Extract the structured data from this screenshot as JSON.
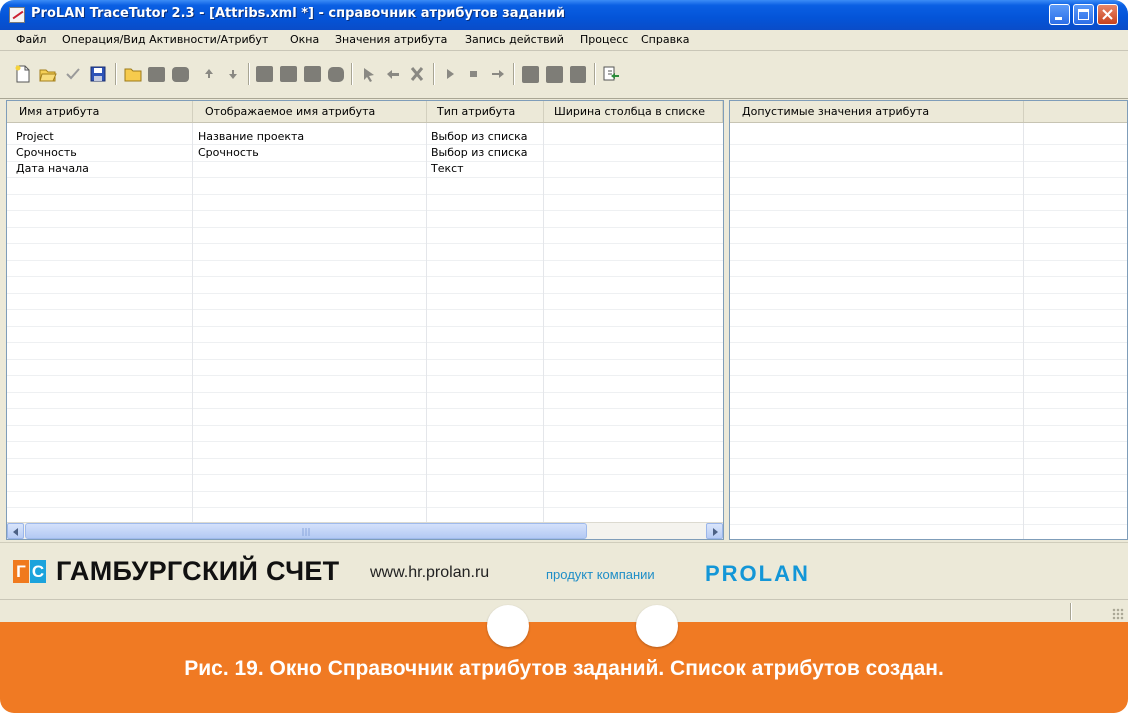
{
  "window": {
    "title": "ProLAN TraceTutor 2.3 - [Attribs.xml *] - справочник атрибутов заданий"
  },
  "menu": {
    "items": [
      "Файл",
      "Операция/Вид Активности/Атрибут",
      "Окна",
      "Значения атрибута",
      "Запись действий",
      "Процесс",
      "Справка"
    ]
  },
  "toolbar": {
    "buttons": [
      {
        "icon": "new-file-icon",
        "enabled": true
      },
      {
        "icon": "open-folder-icon",
        "enabled": true
      },
      {
        "icon": "checkmark-icon",
        "enabled": true
      },
      {
        "icon": "save-icon",
        "enabled": true
      },
      {
        "icon": "folder-icon",
        "enabled": true
      },
      {
        "icon": "add-item-icon",
        "enabled": false
      },
      {
        "icon": "delete-item-icon",
        "enabled": false
      },
      {
        "icon": "move-up-icon",
        "enabled": false
      },
      {
        "icon": "move-down-icon",
        "enabled": false
      },
      {
        "icon": "doc-1-icon",
        "enabled": false
      },
      {
        "icon": "doc-2-icon",
        "enabled": false
      },
      {
        "icon": "doc-3-icon",
        "enabled": false
      },
      {
        "icon": "doc-4-icon",
        "enabled": false
      },
      {
        "icon": "pointer-icon",
        "enabled": false
      },
      {
        "icon": "undo-icon",
        "enabled": false
      },
      {
        "icon": "cut-icon",
        "enabled": false
      },
      {
        "icon": "play-icon",
        "enabled": false
      },
      {
        "icon": "stop-icon",
        "enabled": false
      },
      {
        "icon": "step-icon",
        "enabled": false
      },
      {
        "icon": "record-1-icon",
        "enabled": false
      },
      {
        "icon": "record-2-icon",
        "enabled": false
      },
      {
        "icon": "record-3-icon",
        "enabled": false
      },
      {
        "icon": "export-icon",
        "enabled": true
      }
    ]
  },
  "attributes_table": {
    "columns": [
      "Имя атрибута",
      "Отображаемое имя атрибута",
      "Тип атрибута",
      "Ширина столбца в списке"
    ],
    "rows": [
      [
        "Project",
        "Название проекта",
        "Выбор из списка",
        ""
      ],
      [
        "Срочность",
        "Срочность",
        "Выбор из списка",
        ""
      ],
      [
        "Дата начала",
        "",
        "Текст",
        ""
      ]
    ]
  },
  "values_table": {
    "columns": [
      "Допустимые значения атрибута",
      ""
    ]
  },
  "banner": {
    "logo_letters": [
      "Г",
      "С"
    ],
    "brand": "ГАМБУРГСКИЙ СЧЕТ",
    "website": "www.hr.prolan.ru",
    "product_text": "продукт компании",
    "company_logo": "PROLAN"
  },
  "caption": "Рис. 19. Окно Справочник атрибутов заданий. Список атрибутов создан.",
  "colors": {
    "titlebar_blue": "#0454d8",
    "caption_orange": "#f07a23",
    "brand_blue": "#1396d7",
    "logo_orange": "#f07a1e",
    "logo_blue": "#1ca3dc"
  }
}
